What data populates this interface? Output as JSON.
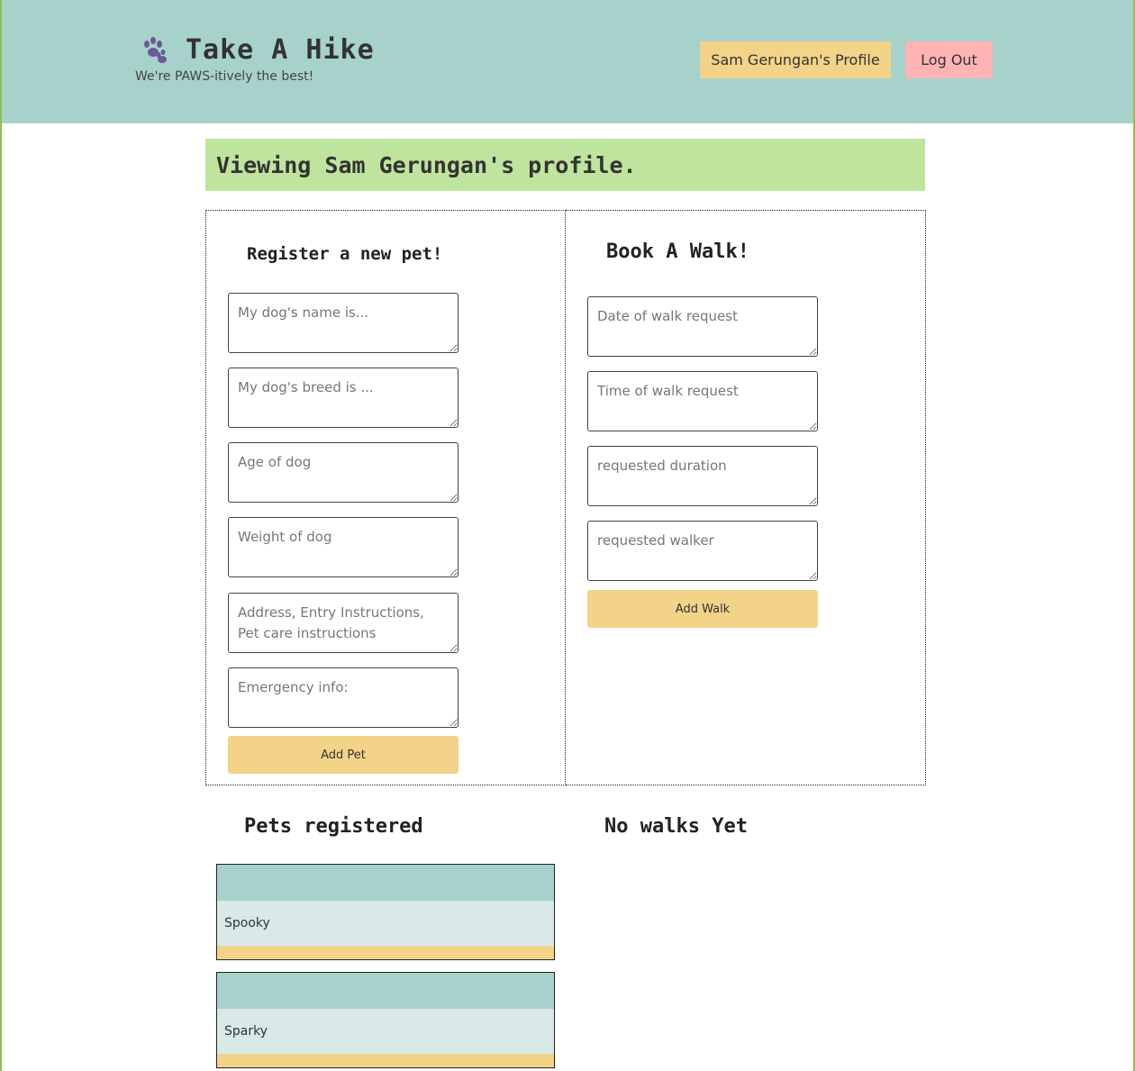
{
  "header": {
    "title": "Take A Hike",
    "tagline": "We're PAWS-itively the best!",
    "brand_icon": "paw-icon",
    "profile_button": "Sam Gerungan's Profile",
    "logout_button": "Log Out"
  },
  "banner": {
    "text": "Viewing Sam Gerungan's profile."
  },
  "pet_form": {
    "title": "Register a new pet!",
    "fields": [
      {
        "placeholder": "My dog's name is...",
        "value": ""
      },
      {
        "placeholder": "My dog's breed is ...",
        "value": ""
      },
      {
        "placeholder": "Age of dog",
        "value": ""
      },
      {
        "placeholder": "Weight of dog",
        "value": ""
      },
      {
        "placeholder": "Address, Entry Instructions, Pet care instructions",
        "value": ""
      },
      {
        "placeholder": "Emergency info:",
        "value": ""
      }
    ],
    "submit_label": "Add Pet"
  },
  "walk_form": {
    "title": "Book A Walk!",
    "fields": [
      {
        "placeholder": "Date of walk request",
        "value": ""
      },
      {
        "placeholder": "Time of walk request",
        "value": ""
      },
      {
        "placeholder": "requested duration",
        "value": ""
      },
      {
        "placeholder": "requested walker",
        "value": ""
      }
    ],
    "submit_label": "Add Walk"
  },
  "pets_section": {
    "title": "Pets registered",
    "pets": [
      {
        "name": "Spooky"
      },
      {
        "name": "Sparky"
      }
    ]
  },
  "walks_section": {
    "title": "No walks Yet"
  },
  "colors": {
    "header_bg": "#a7d2cb",
    "banner_bg": "#bfe49e",
    "button_yellow": "#f2d388",
    "button_pink": "#ffb3b3",
    "card_mid": "#d8e9e7",
    "paw": "#6b5b95"
  }
}
